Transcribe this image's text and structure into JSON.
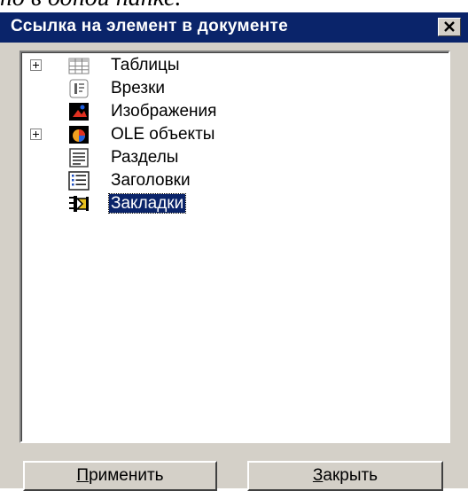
{
  "caption_fragment": "но в одной панке.",
  "window": {
    "title": "Ссылка на элемент в документе",
    "close_icon": "close-icon",
    "colors": {
      "titlebar": "#0a246a",
      "face": "#d4d0c8",
      "selection": "#0a246a"
    }
  },
  "tree": {
    "items": [
      {
        "label": "Таблицы",
        "icon": "table-icon",
        "expandable": true,
        "selected": false
      },
      {
        "label": "Врезки",
        "icon": "frame-icon",
        "expandable": false,
        "selected": false
      },
      {
        "label": "Изображения",
        "icon": "image-icon",
        "expandable": false,
        "selected": false
      },
      {
        "label": "OLE объекты",
        "icon": "ole-object-icon",
        "expandable": true,
        "selected": false
      },
      {
        "label": "Разделы",
        "icon": "section-icon",
        "expandable": false,
        "selected": false
      },
      {
        "label": "Заголовки",
        "icon": "heading-icon",
        "expandable": false,
        "selected": false
      },
      {
        "label": "Закладки",
        "icon": "bookmark-icon",
        "expandable": false,
        "selected": true
      }
    ]
  },
  "buttons": {
    "apply": {
      "accel": "П",
      "rest": "рименить"
    },
    "close": {
      "accel": "З",
      "rest": "акрыть"
    }
  }
}
